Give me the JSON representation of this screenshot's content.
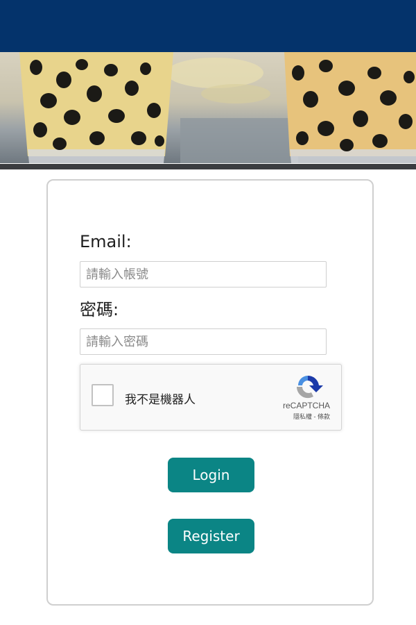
{
  "colors": {
    "topbar": "#04336b",
    "button": "#0b8585",
    "banner_rule": "#3a3c40"
  },
  "banner": {
    "image": "bubble-tea-cups-banner"
  },
  "form": {
    "email_label": "Email:",
    "email_placeholder": "請輸入帳號",
    "email_value": "",
    "password_label": "密碼:",
    "password_placeholder": "請輸入密碼",
    "password_value": ""
  },
  "captcha": {
    "checkbox_label": "我不是機器人",
    "brand": "reCAPTCHA",
    "terms": "隱私權 - 條款",
    "icon": "recaptcha-logo-icon"
  },
  "buttons": {
    "login_label": "Login",
    "register_label": "Register"
  }
}
